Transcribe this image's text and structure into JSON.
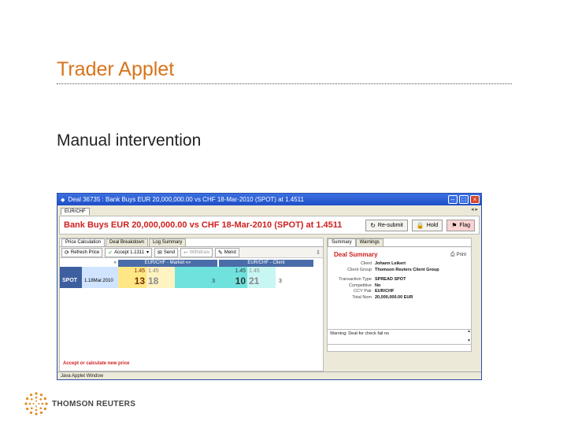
{
  "slide": {
    "title": "Trader Applet",
    "subtitle": "Manual intervention"
  },
  "window": {
    "title": "Deal 36735 : Bank Buys EUR 20,000,000.00 vs CHF 18-Mar-2010 (SPOT) at 1.4511",
    "tab": "EUR/CHF",
    "nav": "◂ ▸",
    "headline": "Bank Buys EUR 20,000,000.00 vs CHF 18-Mar-2010 (SPOT) at 1.4511",
    "actions": {
      "resubmit": "Re-submit",
      "hold": "Hold",
      "flag": "Flag"
    },
    "status_bar": "Java Applet Window",
    "accept_message": "Accept or calculate new price"
  },
  "left_panel": {
    "tabs": [
      "Price Calculation",
      "Deal Breakdown",
      "Log Summary"
    ],
    "toolbar": {
      "refresh": "Refresh Price",
      "accept": "Accept 1.1311",
      "send": "Send",
      "withdraw": "Withdraw",
      "mend": "Mend"
    },
    "grid": {
      "header_arrow": "«",
      "market_header": "EUR/CHF - Market «»",
      "client_header": "EUR/CHF - Client",
      "row_label": "SPOT",
      "row_date": "1.18Mar.2010",
      "market_bid_small": "1.45",
      "market_bid_big": "13",
      "market_ask_small": "1.45",
      "market_ask_big": "18",
      "market_spread": "3",
      "client_bid_small": "1.45",
      "client_bid_big": "10",
      "client_ask_small": "1.45",
      "client_ask_big": "21",
      "client_spread": "3"
    }
  },
  "right_panel": {
    "tabs": [
      "Summary",
      "Warnings"
    ],
    "title": "Deal Summary",
    "print": "Print",
    "rows_a": [
      {
        "k": "Client",
        "v": "Johann Leikert"
      },
      {
        "k": "Client Group",
        "v": "Thomson Reuters Client Group"
      }
    ],
    "rows_b": [
      {
        "k": "Transaction Type",
        "v": "SPREAD SPOT"
      },
      {
        "k": "Competitive",
        "v": "No"
      },
      {
        "k": "CCY Pair",
        "v": "EUR/CHF"
      },
      {
        "k": "Total Nom",
        "v": "20,000,000.00 EUR"
      }
    ],
    "warning": "Warning: Deal-for check fail no"
  },
  "logo": {
    "text": "THOMSON REUTERS"
  }
}
